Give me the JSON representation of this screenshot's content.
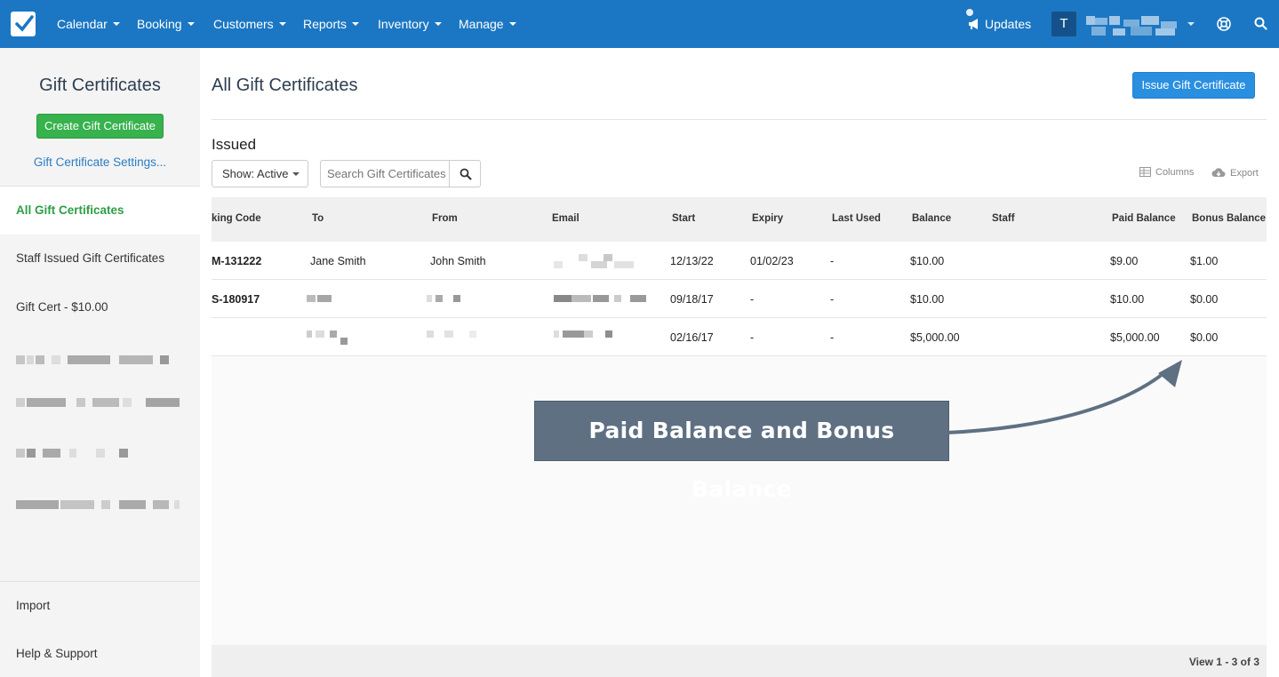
{
  "nav": {
    "items": [
      "Calendar",
      "Booking",
      "Customers",
      "Reports",
      "Inventory",
      "Manage"
    ],
    "updates_label": "Updates",
    "avatar_initial": "T"
  },
  "sidebar": {
    "title": "Gift Certificates",
    "create_button": "Create Gift Certificate",
    "settings_link": "Gift Certificate Settings...",
    "items": [
      "All Gift Certificates",
      "Staff Issued Gift Certificates",
      "Gift Cert - $10.00"
    ],
    "footer": [
      "Import",
      "Help & Support"
    ]
  },
  "main": {
    "title": "All Gift Certificates",
    "issue_button": "Issue Gift Certificate",
    "section_title": "Issued",
    "show_filter": "Show: Active",
    "search_placeholder": "Search Gift Certificates",
    "columns_link": "Columns",
    "export_link": "Export"
  },
  "table": {
    "headers": [
      "king Code",
      "To",
      "From",
      "Email",
      "Start",
      "Expiry",
      "Last Used",
      "Balance",
      "Staff",
      "Paid Balance",
      "Bonus Balance"
    ],
    "rows": [
      {
        "code": "M-131222",
        "to": "Jane Smith",
        "from": "John Smith",
        "start": "12/13/22",
        "expiry": "01/02/23",
        "last_used": "-",
        "balance": "$10.00",
        "paid": "$9.00",
        "bonus": "$1.00"
      },
      {
        "code": "S-180917",
        "to": "",
        "from": "",
        "start": "09/18/17",
        "expiry": "-",
        "last_used": "-",
        "balance": "$10.00",
        "paid": "$10.00",
        "bonus": "$0.00"
      },
      {
        "code": "",
        "to": "",
        "from": "",
        "start": "02/16/17",
        "expiry": "-",
        "last_used": "-",
        "balance": "$5,000.00",
        "paid": "$5,000.00",
        "bonus": "$0.00"
      }
    ],
    "footer": "View 1 - 3 of 3"
  },
  "callout": "Paid Balance and Bonus Balance",
  "colors": {
    "nav_bg": "#1b77c3",
    "create_button": "#37b24d",
    "issue_button": "#2b8fe0",
    "active_item": "#2e9e47",
    "callout_bg": "#5f7083"
  }
}
